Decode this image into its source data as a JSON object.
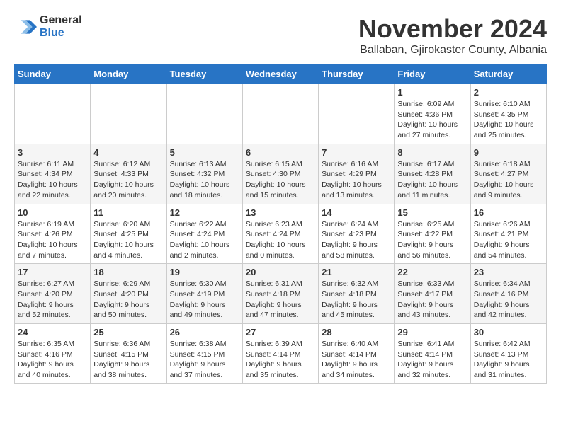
{
  "logo": {
    "general": "General",
    "blue": "Blue"
  },
  "title": "November 2024",
  "subtitle": "Ballaban, Gjirokaster County, Albania",
  "days_of_week": [
    "Sunday",
    "Monday",
    "Tuesday",
    "Wednesday",
    "Thursday",
    "Friday",
    "Saturday"
  ],
  "weeks": [
    [
      {
        "day": "",
        "info": ""
      },
      {
        "day": "",
        "info": ""
      },
      {
        "day": "",
        "info": ""
      },
      {
        "day": "",
        "info": ""
      },
      {
        "day": "",
        "info": ""
      },
      {
        "day": "1",
        "info": "Sunrise: 6:09 AM\nSunset: 4:36 PM\nDaylight: 10 hours and 27 minutes."
      },
      {
        "day": "2",
        "info": "Sunrise: 6:10 AM\nSunset: 4:35 PM\nDaylight: 10 hours and 25 minutes."
      }
    ],
    [
      {
        "day": "3",
        "info": "Sunrise: 6:11 AM\nSunset: 4:34 PM\nDaylight: 10 hours and 22 minutes."
      },
      {
        "day": "4",
        "info": "Sunrise: 6:12 AM\nSunset: 4:33 PM\nDaylight: 10 hours and 20 minutes."
      },
      {
        "day": "5",
        "info": "Sunrise: 6:13 AM\nSunset: 4:32 PM\nDaylight: 10 hours and 18 minutes."
      },
      {
        "day": "6",
        "info": "Sunrise: 6:15 AM\nSunset: 4:30 PM\nDaylight: 10 hours and 15 minutes."
      },
      {
        "day": "7",
        "info": "Sunrise: 6:16 AM\nSunset: 4:29 PM\nDaylight: 10 hours and 13 minutes."
      },
      {
        "day": "8",
        "info": "Sunrise: 6:17 AM\nSunset: 4:28 PM\nDaylight: 10 hours and 11 minutes."
      },
      {
        "day": "9",
        "info": "Sunrise: 6:18 AM\nSunset: 4:27 PM\nDaylight: 10 hours and 9 minutes."
      }
    ],
    [
      {
        "day": "10",
        "info": "Sunrise: 6:19 AM\nSunset: 4:26 PM\nDaylight: 10 hours and 7 minutes."
      },
      {
        "day": "11",
        "info": "Sunrise: 6:20 AM\nSunset: 4:25 PM\nDaylight: 10 hours and 4 minutes."
      },
      {
        "day": "12",
        "info": "Sunrise: 6:22 AM\nSunset: 4:24 PM\nDaylight: 10 hours and 2 minutes."
      },
      {
        "day": "13",
        "info": "Sunrise: 6:23 AM\nSunset: 4:24 PM\nDaylight: 10 hours and 0 minutes."
      },
      {
        "day": "14",
        "info": "Sunrise: 6:24 AM\nSunset: 4:23 PM\nDaylight: 9 hours and 58 minutes."
      },
      {
        "day": "15",
        "info": "Sunrise: 6:25 AM\nSunset: 4:22 PM\nDaylight: 9 hours and 56 minutes."
      },
      {
        "day": "16",
        "info": "Sunrise: 6:26 AM\nSunset: 4:21 PM\nDaylight: 9 hours and 54 minutes."
      }
    ],
    [
      {
        "day": "17",
        "info": "Sunrise: 6:27 AM\nSunset: 4:20 PM\nDaylight: 9 hours and 52 minutes."
      },
      {
        "day": "18",
        "info": "Sunrise: 6:29 AM\nSunset: 4:20 PM\nDaylight: 9 hours and 50 minutes."
      },
      {
        "day": "19",
        "info": "Sunrise: 6:30 AM\nSunset: 4:19 PM\nDaylight: 9 hours and 49 minutes."
      },
      {
        "day": "20",
        "info": "Sunrise: 6:31 AM\nSunset: 4:18 PM\nDaylight: 9 hours and 47 minutes."
      },
      {
        "day": "21",
        "info": "Sunrise: 6:32 AM\nSunset: 4:18 PM\nDaylight: 9 hours and 45 minutes."
      },
      {
        "day": "22",
        "info": "Sunrise: 6:33 AM\nSunset: 4:17 PM\nDaylight: 9 hours and 43 minutes."
      },
      {
        "day": "23",
        "info": "Sunrise: 6:34 AM\nSunset: 4:16 PM\nDaylight: 9 hours and 42 minutes."
      }
    ],
    [
      {
        "day": "24",
        "info": "Sunrise: 6:35 AM\nSunset: 4:16 PM\nDaylight: 9 hours and 40 minutes."
      },
      {
        "day": "25",
        "info": "Sunrise: 6:36 AM\nSunset: 4:15 PM\nDaylight: 9 hours and 38 minutes."
      },
      {
        "day": "26",
        "info": "Sunrise: 6:38 AM\nSunset: 4:15 PM\nDaylight: 9 hours and 37 minutes."
      },
      {
        "day": "27",
        "info": "Sunrise: 6:39 AM\nSunset: 4:14 PM\nDaylight: 9 hours and 35 minutes."
      },
      {
        "day": "28",
        "info": "Sunrise: 6:40 AM\nSunset: 4:14 PM\nDaylight: 9 hours and 34 minutes."
      },
      {
        "day": "29",
        "info": "Sunrise: 6:41 AM\nSunset: 4:14 PM\nDaylight: 9 hours and 32 minutes."
      },
      {
        "day": "30",
        "info": "Sunrise: 6:42 AM\nSunset: 4:13 PM\nDaylight: 9 hours and 31 minutes."
      }
    ]
  ]
}
